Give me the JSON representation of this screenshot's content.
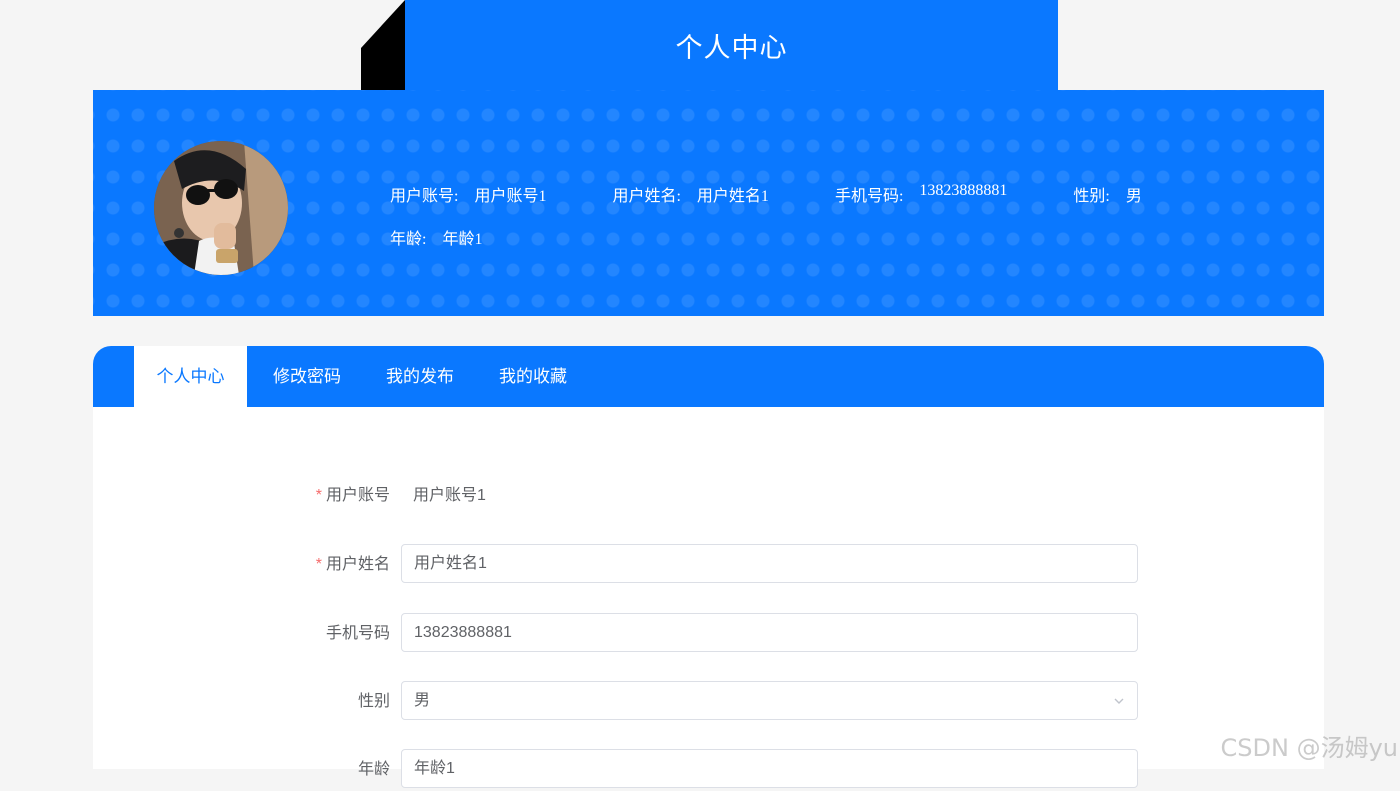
{
  "header": {
    "title": "个人中心"
  },
  "profile": {
    "avatar_alt": "avatar",
    "fields": [
      {
        "label": "用户账号:",
        "value": "用户账号1"
      },
      {
        "label": "用户姓名:",
        "value": "用户姓名1"
      },
      {
        "label": "手机号码:",
        "value": "13823888881"
      },
      {
        "label": "性别:",
        "value": "男"
      },
      {
        "label": "年龄:",
        "value": "年龄1"
      }
    ]
  },
  "tabs": [
    {
      "label": "个人中心",
      "active": true
    },
    {
      "label": "修改密码"
    },
    {
      "label": "我的发布"
    },
    {
      "label": "我的收藏"
    }
  ],
  "form": {
    "required_mark": "*",
    "account": {
      "label": "用户账号",
      "value": "用户账号1"
    },
    "name": {
      "label": "用户姓名",
      "value": "用户姓名1"
    },
    "phone": {
      "label": "手机号码",
      "value": "13823888881"
    },
    "gender": {
      "label": "性别",
      "value": "男"
    },
    "age": {
      "label": "年龄",
      "value": "年龄1"
    }
  },
  "watermark": "CSDN @汤姆yu",
  "colors": {
    "primary": "#0a78ff",
    "page_bg": "#f5f5f5",
    "required": "#f56c6c"
  },
  "icons": {
    "select_arrow": "chevron-down-icon"
  }
}
